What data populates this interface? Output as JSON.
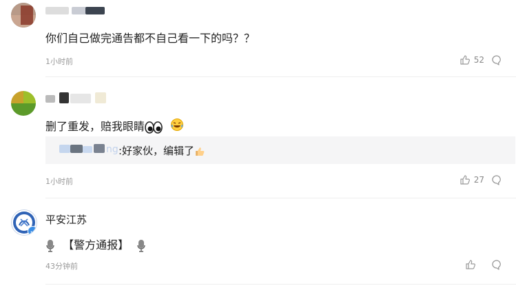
{
  "comments": [
    {
      "text": "你们自己做完通告都不自己看一下的吗？？",
      "time": "1小时前",
      "likes": "52"
    },
    {
      "text": "删了重发，赔我眼睛",
      "time": "1小时前",
      "likes": "27",
      "reply_user_suffix": "ng",
      "reply_text": ":好家伙，编辑了"
    },
    {
      "name": "平安江苏",
      "text": "【警方通报】",
      "time": "43分钟前"
    }
  ]
}
